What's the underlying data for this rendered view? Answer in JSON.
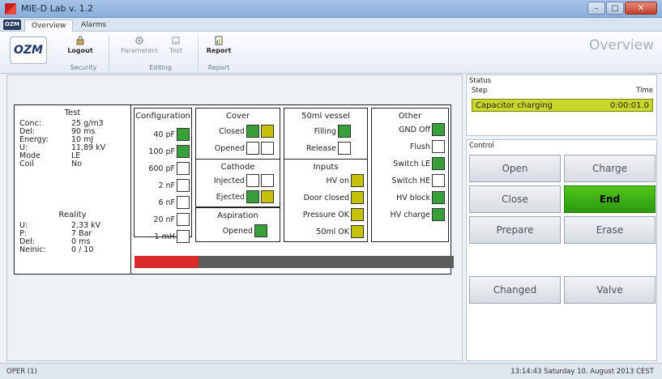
{
  "window": {
    "title": "MIE-D Lab v. 1.2",
    "min": "–",
    "max": "□",
    "close": "✕"
  },
  "tabs": {
    "app": "OZM",
    "items": [
      "Overview",
      "Alarms"
    ]
  },
  "ribbon": {
    "logo": "OZM",
    "buttons": [
      {
        "label": "Logout",
        "icon": "lock-icon"
      },
      {
        "label": "Parameters",
        "icon": "gear-icon"
      },
      {
        "label": "Test",
        "icon": "test-icon"
      },
      {
        "label": "Report",
        "icon": "report-icon"
      }
    ],
    "groups": [
      "Security",
      "Editing",
      "Report"
    ],
    "page_title": "Overview"
  },
  "test": {
    "title": "Test",
    "rows": [
      {
        "k": "Conc:",
        "v": "25 g/m3"
      },
      {
        "k": "Del:",
        "v": "90 ms"
      },
      {
        "k": "Energy:",
        "v": "10 mJ"
      },
      {
        "k": "U:",
        "v": "11,89 kV"
      },
      {
        "k": "Mode",
        "v": "LE"
      },
      {
        "k": "Coil",
        "v": "No"
      }
    ],
    "reality_title": "Reality",
    "reality": [
      {
        "k": "U:",
        "v": "2,33 kV"
      },
      {
        "k": "P:",
        "v": "7 Bar"
      },
      {
        "k": "Del:",
        "v": "0 ms"
      },
      {
        "k": "Neinic:",
        "v": "0 / 10"
      }
    ]
  },
  "configuration": {
    "title": "Configuration",
    "items": [
      {
        "label": "40 pF",
        "state": "green"
      },
      {
        "label": "100 pF",
        "state": "green"
      },
      {
        "label": "600 pF",
        "state": "off"
      },
      {
        "label": "2 nF",
        "state": "off"
      },
      {
        "label": "6 nF",
        "state": "off"
      },
      {
        "label": "20 nF",
        "state": "off"
      },
      {
        "label": "1 mH",
        "state": "off"
      }
    ]
  },
  "cover": {
    "title": "Cover",
    "items": [
      {
        "label": "Closed",
        "a": "green",
        "b": "yellow"
      },
      {
        "label": "Opened",
        "a": "off",
        "b": "off"
      }
    ]
  },
  "cathode": {
    "title": "Cathode",
    "items": [
      {
        "label": "Injected",
        "a": "off",
        "b": "off"
      },
      {
        "label": "Ejected",
        "a": "green",
        "b": "yellow"
      }
    ]
  },
  "aspiration": {
    "title": "Aspiration",
    "items": [
      {
        "label": "Opened",
        "state": "green"
      }
    ]
  },
  "vessel": {
    "title": "50ml vessel",
    "items": [
      {
        "label": "Filling",
        "state": "green"
      },
      {
        "label": "Release",
        "state": "off"
      }
    ]
  },
  "inputs": {
    "title": "Inputs",
    "items": [
      {
        "label": "HV on",
        "state": "yellow"
      },
      {
        "label": "Door closed",
        "state": "yellow"
      },
      {
        "label": "Pressure OK",
        "state": "yellow"
      },
      {
        "label": "50ml OK",
        "state": "yellow"
      }
    ]
  },
  "other": {
    "title": "Other",
    "items": [
      {
        "label": "GND Off",
        "state": "green"
      },
      {
        "label": "Flush",
        "state": "off"
      },
      {
        "label": "Switch LE",
        "state": "green"
      },
      {
        "label": "Switch HE",
        "state": "off"
      },
      {
        "label": "HV block",
        "state": "green"
      },
      {
        "label": "HV charge",
        "state": "green"
      }
    ]
  },
  "progress": {
    "value": 0.2
  },
  "status": {
    "title": "Status",
    "col_step": "Step",
    "col_time": "Time",
    "step": "Capacitor charging",
    "time": "0:00:01.0",
    "row_color": "#c9d72c"
  },
  "control": {
    "title": "Control",
    "buttons": [
      "Open",
      "Charge",
      "Close",
      "End",
      "Prepare",
      "Erase",
      "Changed",
      "Valve"
    ]
  },
  "statusbar": {
    "left": "OPER (1)",
    "right": "13:14:43 Saturday 10. August 2013 CEST"
  }
}
